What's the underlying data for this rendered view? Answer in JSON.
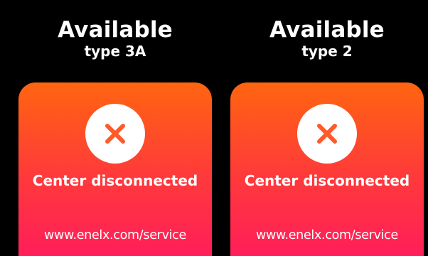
{
  "colors": {
    "background": "#000000",
    "text": "#ffffff",
    "card_gradient_top": "#ff6510",
    "card_gradient_mid": "#ff3a3a",
    "card_gradient_bottom": "#ff1a5e",
    "icon_circle": "#ffffff",
    "icon_x": "#ff5a2a"
  },
  "connectors": [
    {
      "status": "Available",
      "type": "type 3A",
      "icon": "close-x-icon",
      "message": "Center disconnected",
      "service_url": "www.enelx.com/service"
    },
    {
      "status": "Available",
      "type": "type 2",
      "icon": "close-x-icon",
      "message": "Center disconnected",
      "service_url": "www.enelx.com/service"
    }
  ]
}
